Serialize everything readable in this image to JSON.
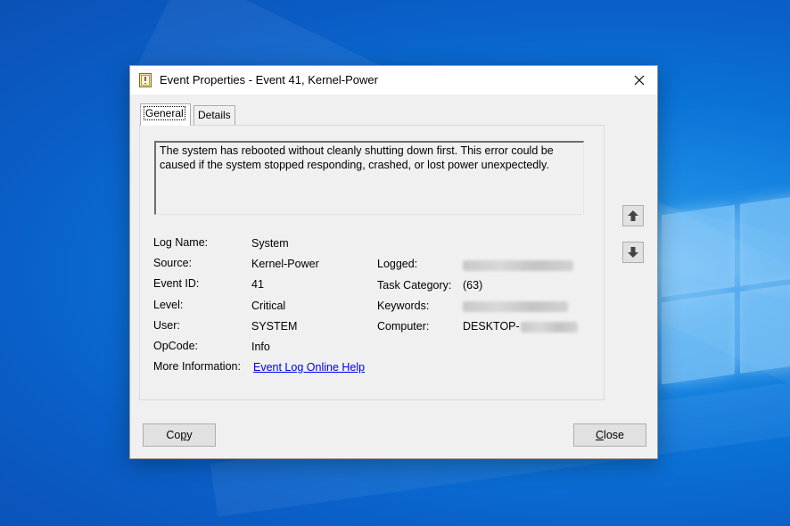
{
  "window": {
    "title": "Event Properties - Event 41, Kernel-Power",
    "close_glyph": "✕"
  },
  "tabs": [
    {
      "label": "General",
      "active": true
    },
    {
      "label": "Details",
      "active": false
    }
  ],
  "general": {
    "description": "The system has rebooted without cleanly shutting down first. This error could be caused if the system stopped responding, crashed, or lost power unexpectedly.",
    "fields": {
      "log_name": {
        "label": "Log Name:",
        "value": "System"
      },
      "source": {
        "label": "Source:",
        "value": "Kernel-Power"
      },
      "event_id": {
        "label": "Event ID:",
        "value": "41"
      },
      "level": {
        "label": "Level:",
        "value": "Critical"
      },
      "user": {
        "label": "User:",
        "value": "SYSTEM"
      },
      "opcode": {
        "label": "OpCode:",
        "value": "Info"
      },
      "more_info": {
        "label": "More Information:",
        "link": "Event Log Online Help"
      },
      "logged": {
        "label": "Logged:",
        "redacted": true
      },
      "task_category": {
        "label": "Task Category:",
        "value": "(63)"
      },
      "keywords": {
        "label": "Keywords:",
        "redacted": true
      },
      "computer": {
        "label": "Computer:",
        "value_prefix": "DESKTOP-",
        "redacted_suffix": true
      }
    }
  },
  "navigation": {
    "up_icon": "arrow-up-icon",
    "down_icon": "arrow-down-icon"
  },
  "buttons": {
    "copy": {
      "label_plain_prefix": "Co",
      "label_mnemonic": "p",
      "label_plain_suffix": "y"
    },
    "close": {
      "label_mnemonic": "C",
      "label_plain_suffix": "lose"
    }
  },
  "colors": {
    "desktop_blue": "#0a73d8",
    "dialog_bg": "#f0f0f0",
    "link": "#0000ee",
    "button_bg": "#e1e1e1"
  }
}
